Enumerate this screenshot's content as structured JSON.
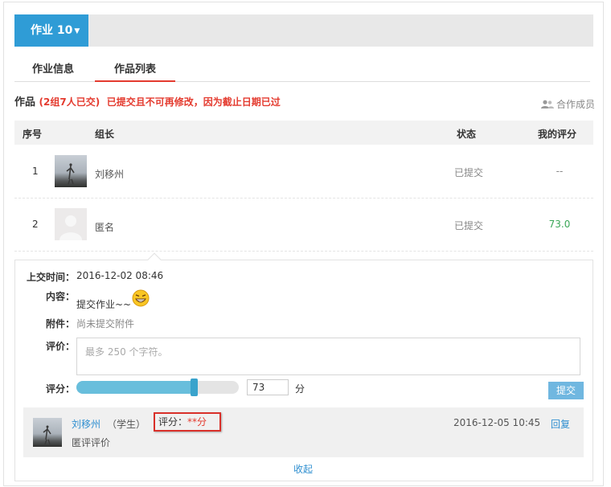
{
  "homework": {
    "title": "作业 10"
  },
  "tabs": [
    {
      "label": "作业信息"
    },
    {
      "label": "作品列表"
    }
  ],
  "works": {
    "title": "作品",
    "count_text": "(2组7人已交)",
    "warning": "已提交且不可再修改，因为截止日期已过",
    "members_label": "合作成员"
  },
  "table": {
    "headers": {
      "index": "序号",
      "leader": "组长",
      "status": "状态",
      "my_score": "我的评分"
    },
    "rows": [
      {
        "index": "1",
        "name": "刘移州",
        "status": "已提交",
        "score": "--"
      },
      {
        "index": "2",
        "name": "匿名",
        "status": "已提交",
        "score": "73.0"
      }
    ]
  },
  "detail": {
    "submit_time_label": "上交时间：",
    "submit_time": "2016-12-02 08:46",
    "content_label": "内容：",
    "content": "提交作业~~",
    "attachment_label": "附件：",
    "attachment": "尚未提交附件",
    "review_label": "评价：",
    "review_placeholder": "最多 250 个字符。",
    "score_label": "评分：",
    "score_value": "73",
    "score_unit": "分",
    "slider_fraction": 0.73,
    "submit_button": "提交"
  },
  "comment": {
    "name": "刘移州",
    "role": "（学生）",
    "score_label": "评分：",
    "score_value": "**分",
    "body": "匿评评价",
    "date": "2016-12-05 10:45",
    "reply": "回复"
  },
  "collapse_label": "收起",
  "colors": {
    "accent": "#2f9cd6",
    "warning": "#e43b2f",
    "green": "#3aa657",
    "link": "#2f8fd0"
  }
}
